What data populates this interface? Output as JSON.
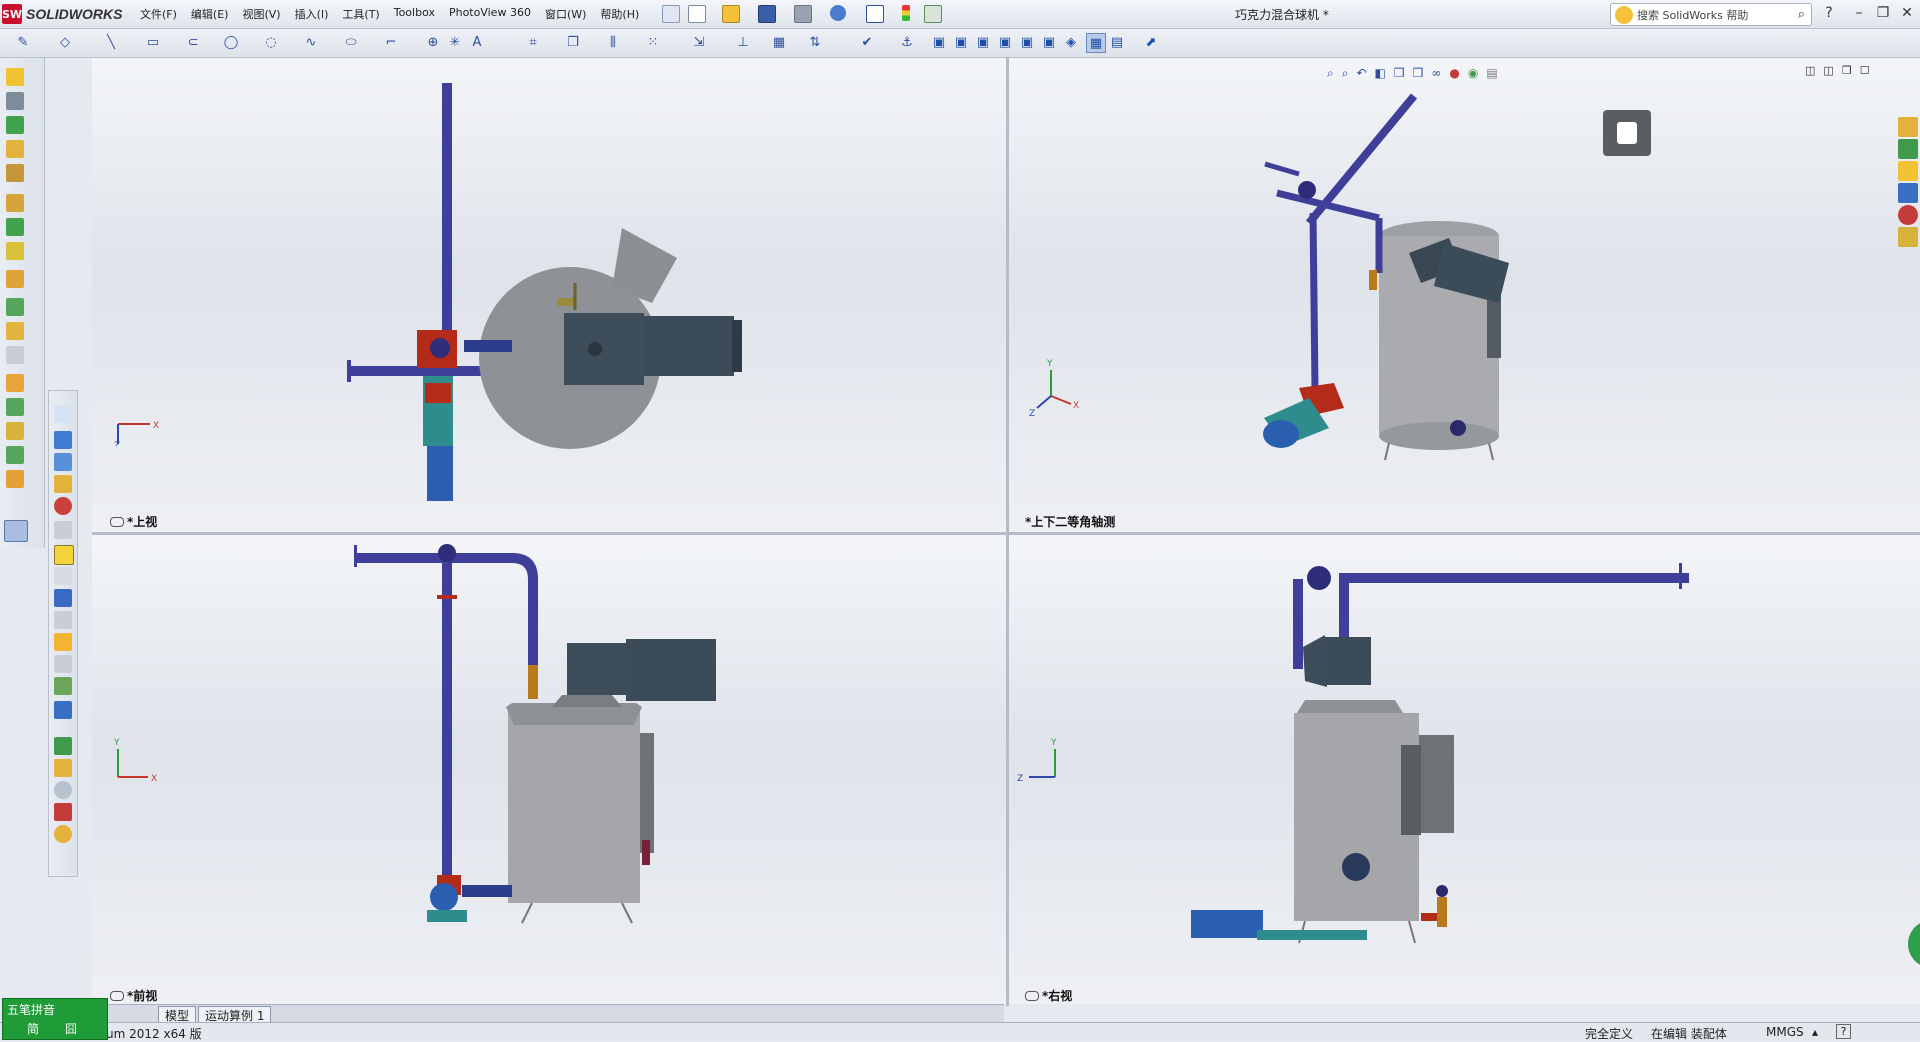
{
  "app": {
    "brand": "SOLIDWORKS",
    "brand_badge": "SW",
    "document_title": "巧克力混合球机 *"
  },
  "menu": [
    "文件(F)",
    "编辑(E)",
    "视图(V)",
    "插入(I)",
    "工具(T)",
    "Toolbox",
    "PhotoView 360",
    "窗口(W)",
    "帮助(H)"
  ],
  "search": {
    "placeholder": "搜索 SolidWorks 帮助"
  },
  "viewports": {
    "top_left": {
      "label": "*上视"
    },
    "top_right": {
      "label": "*上下二等角轴测"
    },
    "bottom_left": {
      "label": "*前视"
    },
    "bottom_right": {
      "label": "*右视"
    }
  },
  "triad": {
    "x": "X",
    "y": "Y",
    "z": "Z"
  },
  "tabs": [
    "模型",
    "运动算例 1"
  ],
  "status": {
    "version": "um 2012 x64 版",
    "definition": "完全定义",
    "editing": "在编辑 装配体",
    "units": "MMGS",
    "units_caret": "▴",
    "help": "?"
  },
  "ime": {
    "line1": "五笔拼音",
    "line2": "简",
    "line3": "囧"
  },
  "colors": {
    "pipe": "#3f3f9a",
    "tank": "#a3a5a8",
    "motor": "#3c4b58",
    "valve": "#b52b1a",
    "pump_blue": "#2a5fb0",
    "teal": "#2f8c8c",
    "orange": "#b87a1c"
  },
  "icons": [
    "zoom-fit-icon",
    "zoom-area-icon",
    "previous-view-icon",
    "section-view-icon",
    "view-orientation-icon",
    "display-style-icon",
    "hide-show-icon",
    "appearance-icon",
    "scene-icon",
    "render-icon"
  ]
}
